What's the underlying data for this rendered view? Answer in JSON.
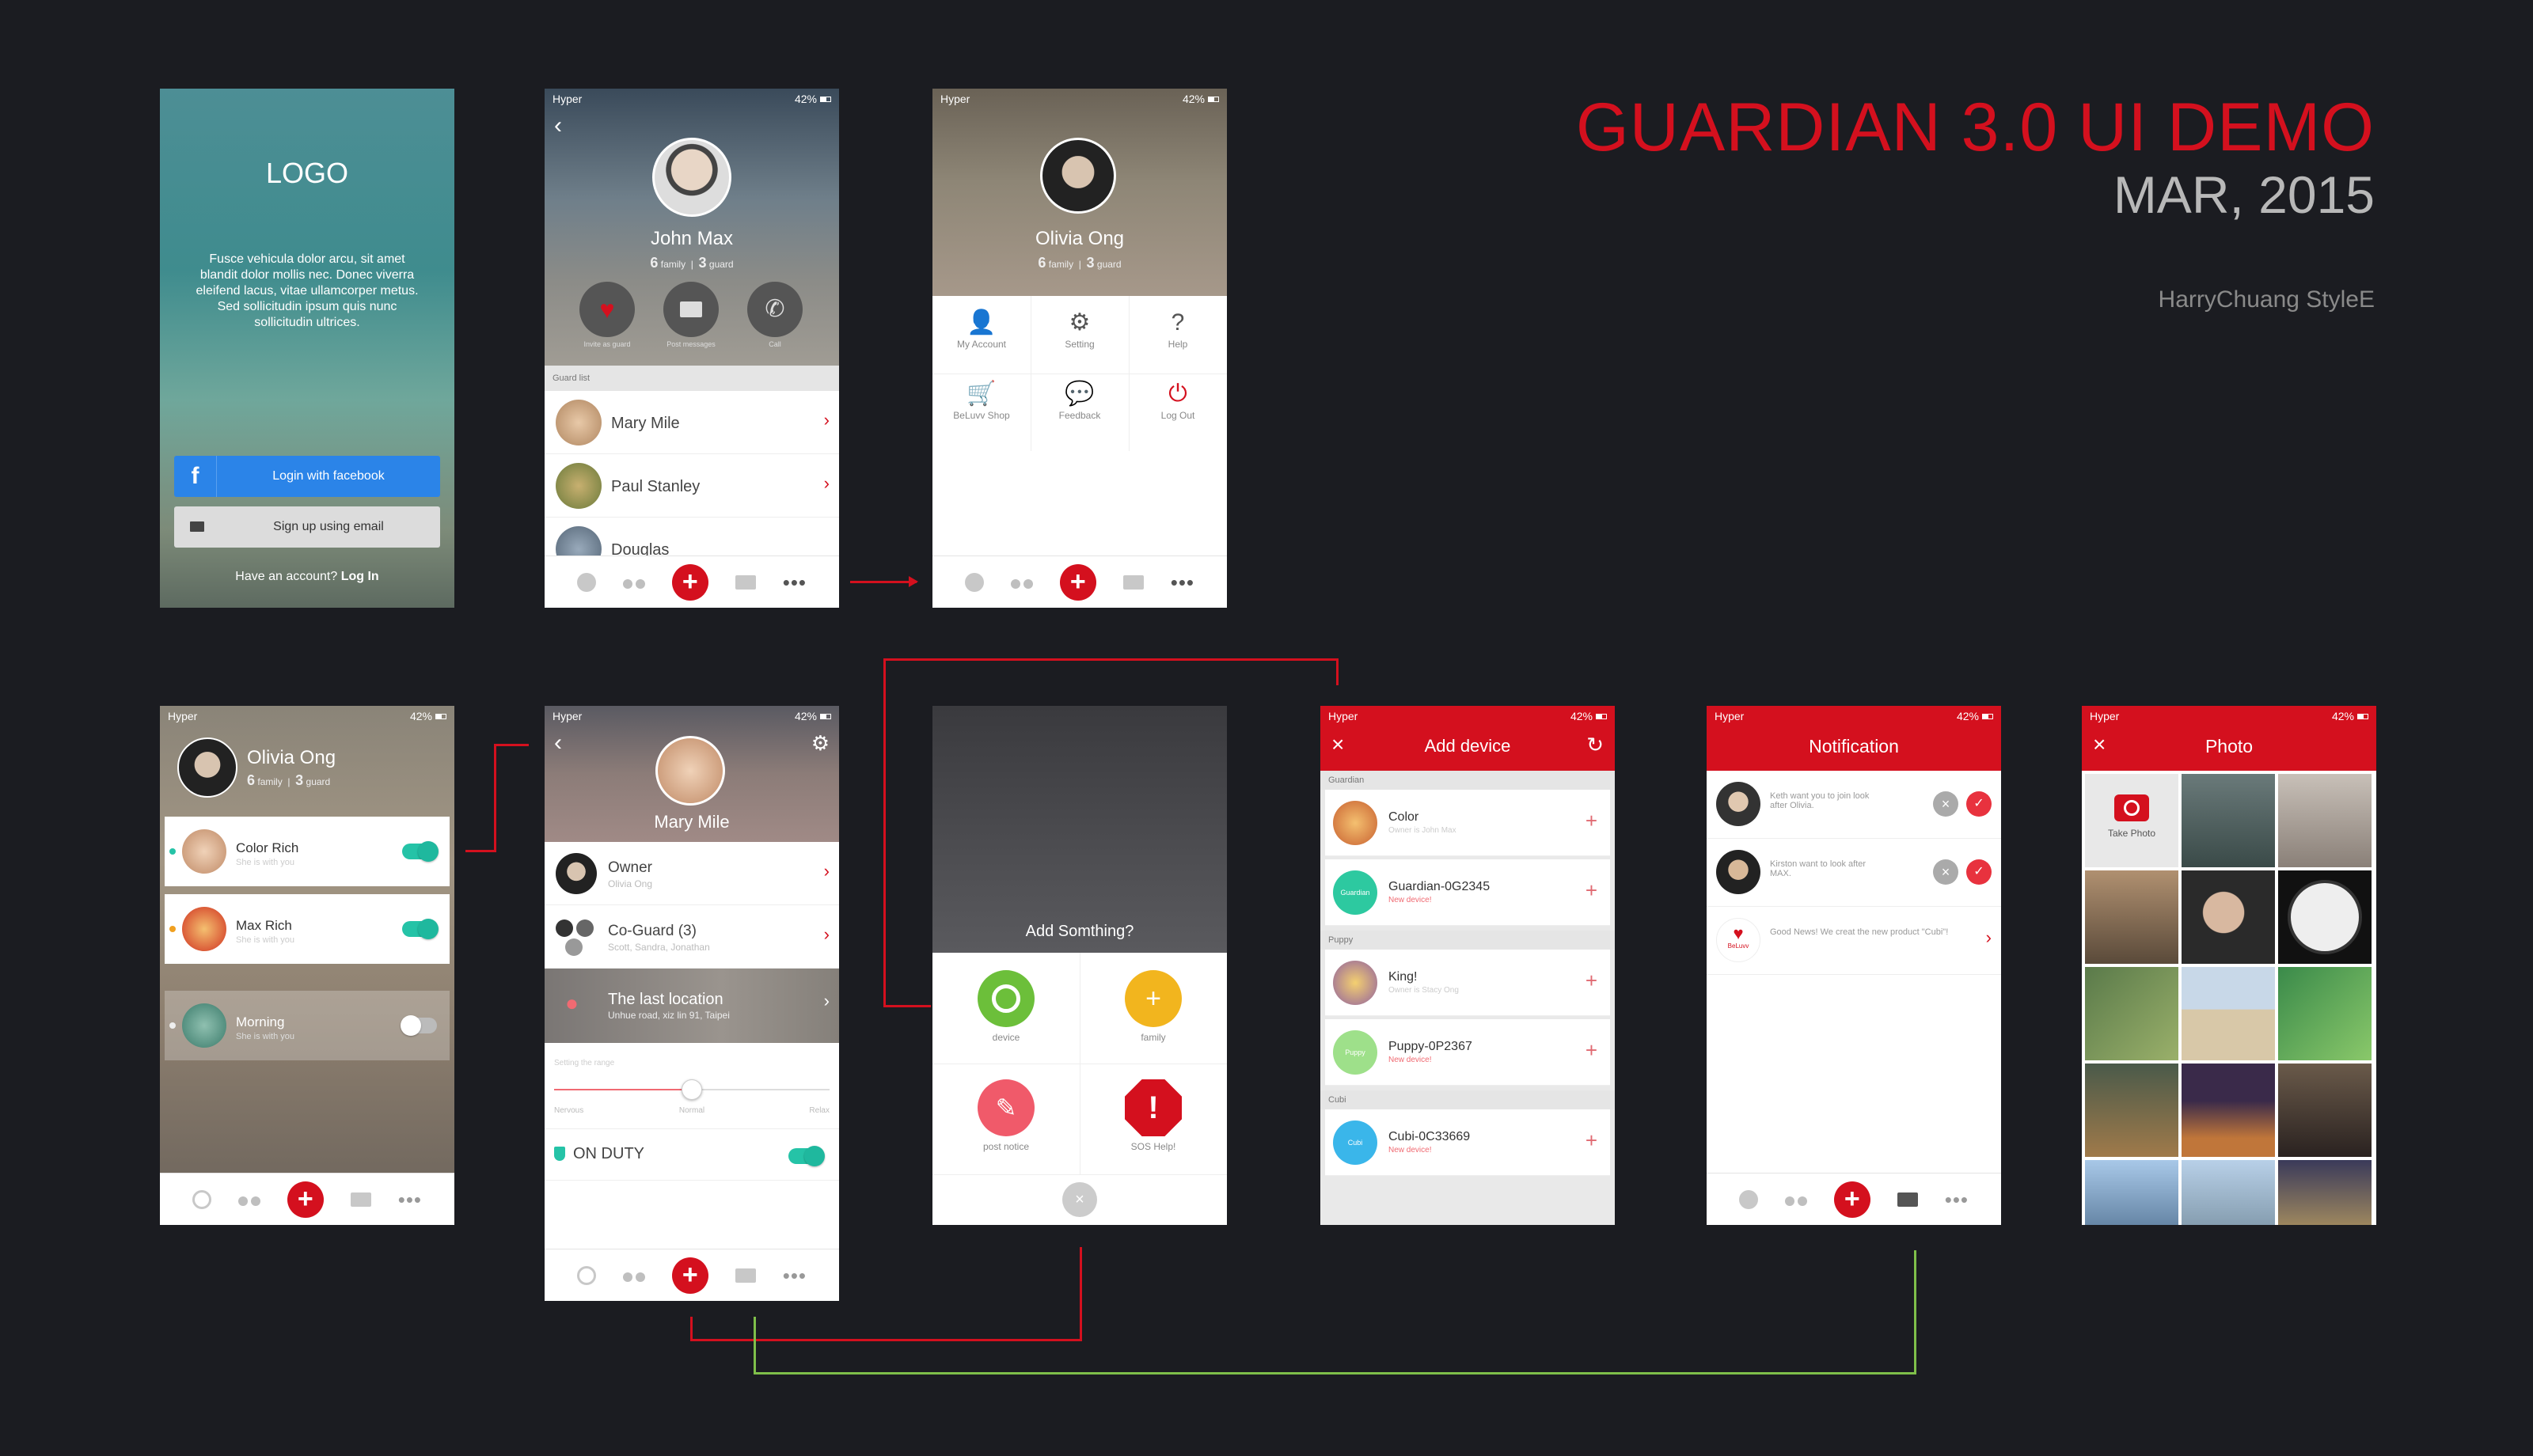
{
  "header": {
    "title": "GUARDIAN 3.0 UI DEMO",
    "date": "MAR, 2015",
    "author": "HarryChuang StyleE"
  },
  "status": {
    "carrier": "Hyper",
    "battery": "42%"
  },
  "login": {
    "logo": "LOGO",
    "body": "Fusce vehicula dolor arcu, sit amet blandit dolor mollis nec. Donec viverra eleifend lacus, vitae ullamcorper metus. Sed sollicitudin ipsum quis nunc sollicitudin ultrices.",
    "facebook_label": "Login with facebook",
    "email_label": "Sign up using email",
    "have_account": "Have an account?",
    "login_link": "Log In"
  },
  "profile_john": {
    "name": "John Max",
    "family_count": "6",
    "family_label": "family",
    "guard_count": "3",
    "guard_label": "guard",
    "actions": [
      "Invite as guard",
      "Post messages",
      "Call"
    ],
    "section": "Guard list",
    "guards": [
      "Mary Mile",
      "Paul Stanley",
      "Douglas"
    ]
  },
  "menu_olivia": {
    "name": "Olivia Ong",
    "family_count": "6",
    "family_label": "family",
    "guard_count": "3",
    "guard_label": "guard",
    "items": [
      "My Account",
      "Setting",
      "Help",
      "BeLuvv Shop",
      "Feedback",
      "Log Out"
    ]
  },
  "family_list": {
    "name": "Olivia Ong",
    "family_count": "6",
    "family_label": "family",
    "guard_count": "3",
    "guard_label": "guard",
    "items": [
      {
        "name": "Color Rich",
        "sub": "She is with you"
      },
      {
        "name": "Max Rich",
        "sub": "She is with you"
      },
      {
        "name": "Morning",
        "sub": "She is with you"
      }
    ]
  },
  "mary_detail": {
    "name": "Mary Mile",
    "owner_label": "Owner",
    "owner_sub": "Olivia Ong",
    "coguard_label": "Co-Guard (3)",
    "coguard_sub": "Scott, Sandra, Jonathan",
    "location_label": "The last location",
    "location_sub": "Unhue road, xiz lin 91, Taipei",
    "range_label": "Setting the range",
    "range_min": "Nervous",
    "range_mid": "Normal",
    "range_max": "Relax",
    "range_value": 0.5,
    "duty_label": "ON DUTY"
  },
  "add_something": {
    "title": "Add Somthing?",
    "options": [
      "device",
      "family",
      "post notice",
      "SOS Help!"
    ]
  },
  "add_device": {
    "title": "Add device",
    "sections": [
      {
        "name": "Guardian",
        "items": [
          {
            "name": "Color",
            "sub": "Owner is John Max",
            "badge": ""
          },
          {
            "name": "Guardian-0G2345",
            "sub": "New device!",
            "badge": "Guardian"
          }
        ]
      },
      {
        "name": "Puppy",
        "items": [
          {
            "name": "King!",
            "sub": "Owner is Stacy Ong",
            "badge": ""
          },
          {
            "name": "Puppy-0P2367",
            "sub": "New device!",
            "badge": "Puppy"
          }
        ]
      },
      {
        "name": "Cubi",
        "items": [
          {
            "name": "Cubi-0C33669",
            "sub": "New device!",
            "badge": "Cubi"
          }
        ]
      }
    ]
  },
  "notification": {
    "title": "Notification",
    "items": [
      "Keth want you to join look after Olivia.",
      "Kirston want to look after MAX.",
      "Good News! We creat the new product \"Cubi\"!"
    ],
    "brand_badge": "BeLuvv"
  },
  "photo": {
    "title": "Photo",
    "take_photo": "Take Photo"
  },
  "colors": {
    "accent": "#d4101e",
    "teal": "#25c3a7",
    "facebook": "#2b84e8",
    "background": "#1b1c21",
    "connector_green": "#7fbf4a"
  }
}
